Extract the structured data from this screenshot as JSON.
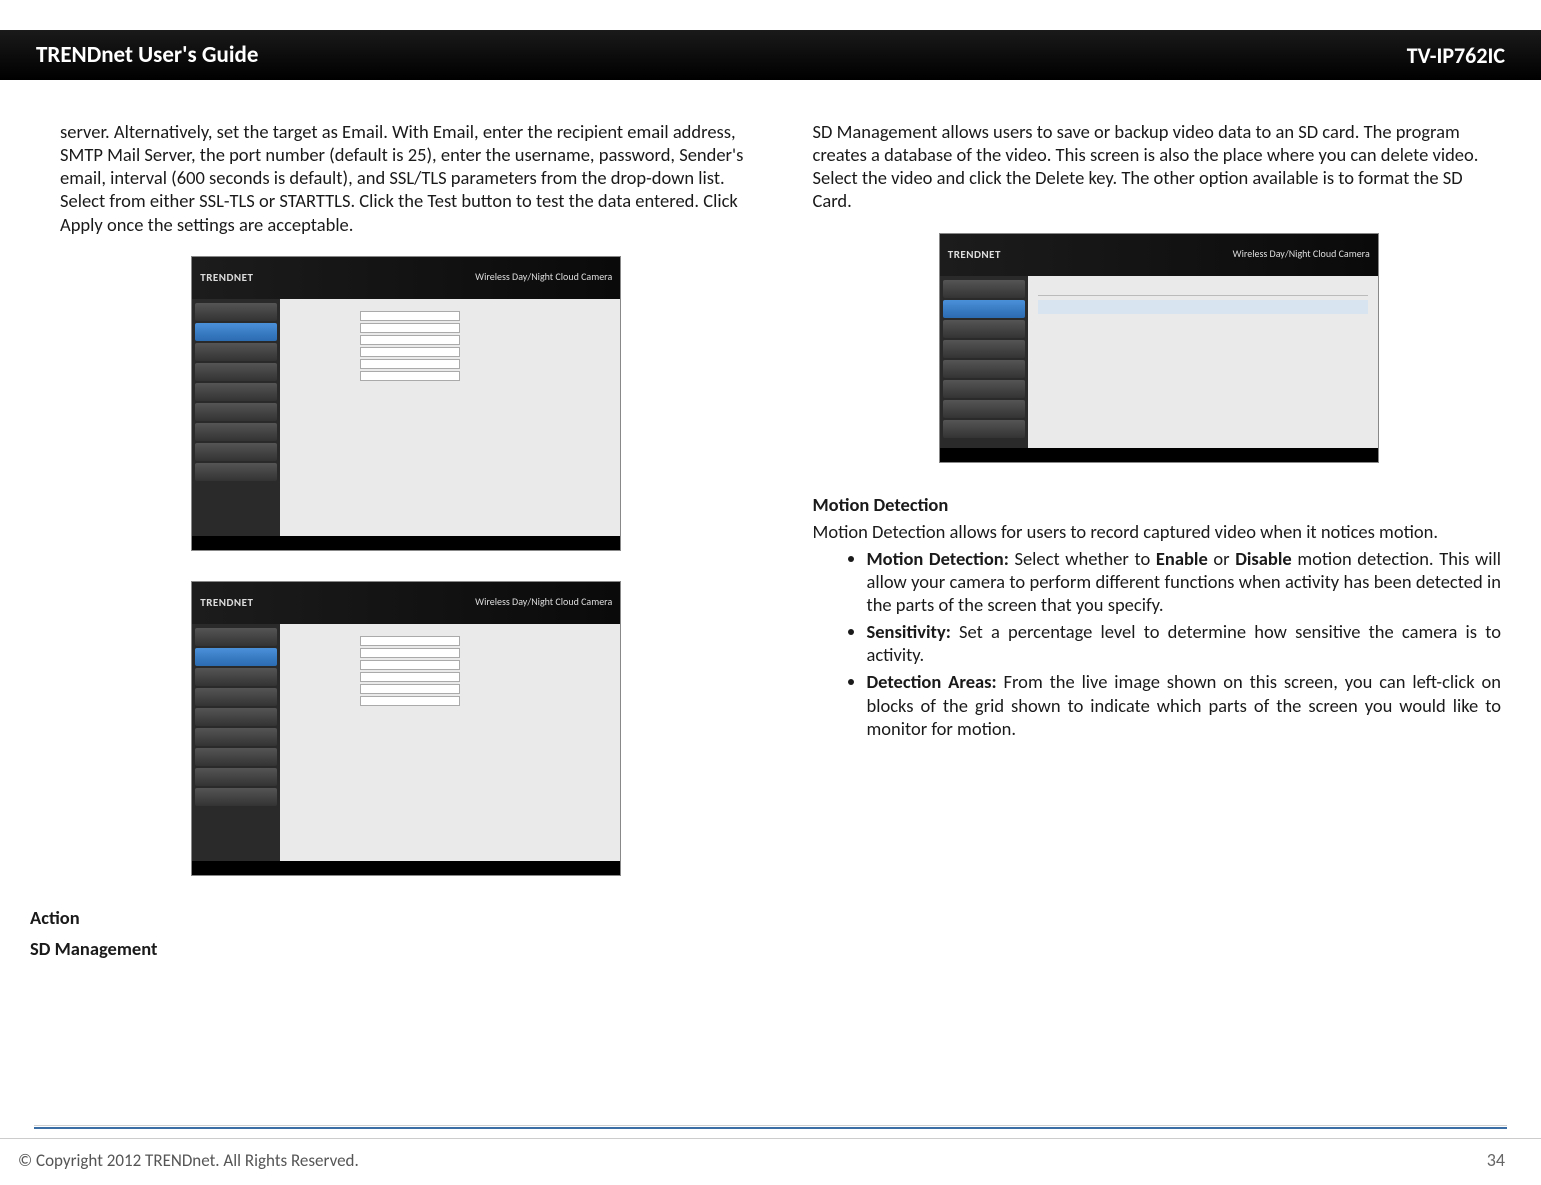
{
  "header": {
    "left": "TRENDnet User's Guide",
    "right": "TV-IP762IC"
  },
  "left_column": {
    "para1": "server. Alternatively, set the target as Email. With Email, enter the recipient email address, SMTP Mail Server, the port number (default is 25), enter the username, password, Sender's email, interval (600 seconds is default), and SSL/TLS parameters from the drop-down list. Select from either SSL-TLS or STARTTLS. Click the Test button to test the data entered. Click Apply once the settings are acceptable.",
    "heading1": "Action",
    "heading2": "SD Management"
  },
  "right_column": {
    "para1": "SD Management allows users to save or backup video data to an SD card. The program creates a database of the video. This screen is also the place where you can delete video. Select the video and click the Delete key. The other option available is to format the SD Card.",
    "heading1": "Motion Detection",
    "para2": "Motion Detection allows for users to record captured video when it notices motion.",
    "bullets": [
      {
        "label": "Motion Detection:",
        "text": " Select whether to ",
        "bold1": "Enable",
        "mid": " or ",
        "bold2": "Disable",
        "rest": " motion detection. This will allow your camera to perform different functions when activity has been detected in the parts of the screen that you specify."
      },
      {
        "label": "Sensitivity:",
        "text": " Set a percentage level to determine how sensitive the camera is to activity."
      },
      {
        "label": "Detection Areas:",
        "text": " From the live image shown on this screen, you can left-click on blocks of the grid shown to indicate which parts of the screen you would like to monitor for motion."
      }
    ]
  },
  "mock": {
    "brand": "TRENDNET",
    "title": "Wireless Day/Night Cloud Camera"
  },
  "footer": {
    "copyright": "© Copyright 2012 TRENDnet. All Rights Reserved.",
    "page": "34"
  }
}
